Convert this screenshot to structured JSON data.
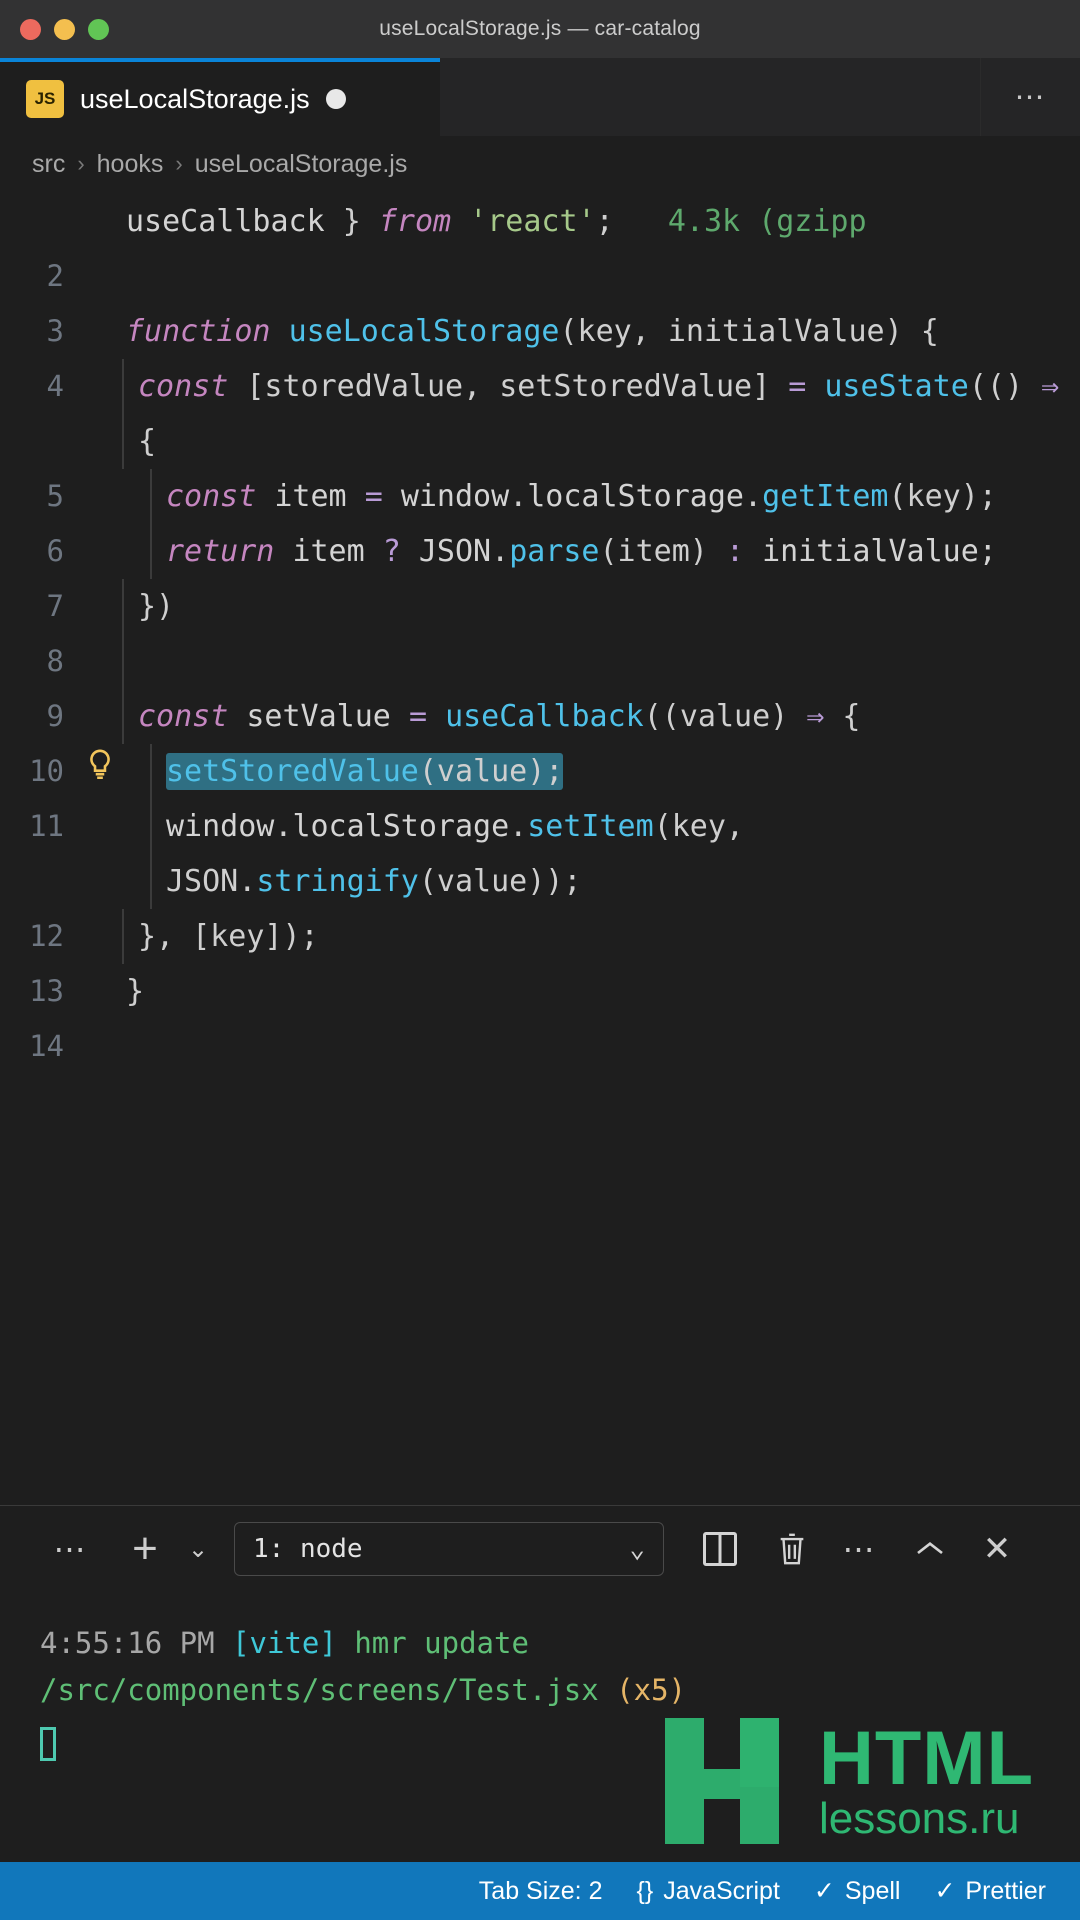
{
  "titlebar": {
    "title": "useLocalStorage.js — car-catalog",
    "traffic_lights": [
      "close-red",
      "minimize-yellow",
      "maximize-green"
    ],
    "colors": {
      "red": "#ec6a5e",
      "yellow": "#f4bf4f",
      "green": "#61c555"
    }
  },
  "tabbar": {
    "active_tab": {
      "icon": "JS",
      "label": "useLocalStorage.js",
      "dirty": true
    },
    "more_actions": "⋯"
  },
  "breadcrumb": {
    "items": [
      "src",
      "hooks",
      "useLocalStorage.js"
    ],
    "separator": "›"
  },
  "editor": {
    "language": "JavaScript",
    "lines": [
      {
        "number": "",
        "bulb": false,
        "indent": 0,
        "tokens": [
          {
            "t": "useCallback ",
            "c": "plain"
          },
          {
            "t": "} ",
            "c": "punc"
          },
          {
            "t": "from ",
            "c": "kw"
          },
          {
            "t": "'react'",
            "c": "strq"
          },
          {
            "t": ";",
            "c": "punc"
          },
          {
            "t": "   4.3k (gzipp",
            "c": "cost"
          }
        ]
      },
      {
        "number": "2",
        "bulb": false,
        "indent": 0,
        "tokens": []
      },
      {
        "number": "3",
        "bulb": false,
        "indent": 0,
        "tokens": [
          {
            "t": "function ",
            "c": "kw"
          },
          {
            "t": "useLocalStorage",
            "c": "fn2"
          },
          {
            "t": "(key, initialValue) {",
            "c": "punc"
          }
        ]
      },
      {
        "number": "4",
        "bulb": false,
        "indent": 1,
        "tokens": [
          {
            "t": "const ",
            "c": "kw"
          },
          {
            "t": "[storedValue, setStoredValue] ",
            "c": "punc"
          },
          {
            "t": "= ",
            "c": "op"
          },
          {
            "t": "useState",
            "c": "fn2"
          },
          {
            "t": "(() ",
            "c": "punc"
          },
          {
            "t": "⇒",
            "c": "arrow"
          },
          {
            "t": " {",
            "c": "punc"
          }
        ]
      },
      {
        "number": "5",
        "bulb": false,
        "indent": 2,
        "tokens": [
          {
            "t": "const ",
            "c": "kw"
          },
          {
            "t": "item ",
            "c": "plain"
          },
          {
            "t": "= ",
            "c": "op"
          },
          {
            "t": "window",
            "c": "plain"
          },
          {
            "t": ".",
            "c": "punc"
          },
          {
            "t": "localStorage",
            "c": "plain"
          },
          {
            "t": ".",
            "c": "punc"
          },
          {
            "t": "getItem",
            "c": "fn2"
          },
          {
            "t": "(key);",
            "c": "punc"
          }
        ]
      },
      {
        "number": "6",
        "bulb": false,
        "indent": 2,
        "tokens": [
          {
            "t": "return ",
            "c": "kw"
          },
          {
            "t": "item ",
            "c": "plain"
          },
          {
            "t": "? ",
            "c": "op"
          },
          {
            "t": "JSON",
            "c": "plain"
          },
          {
            "t": ".",
            "c": "punc"
          },
          {
            "t": "parse",
            "c": "fn2"
          },
          {
            "t": "(item) ",
            "c": "punc"
          },
          {
            "t": ": ",
            "c": "op"
          },
          {
            "t": "initialValue;",
            "c": "plain"
          }
        ]
      },
      {
        "number": "7",
        "bulb": false,
        "indent": 1,
        "tokens": [
          {
            "t": "})",
            "c": "punc"
          }
        ]
      },
      {
        "number": "8",
        "bulb": false,
        "indent": 1,
        "tokens": []
      },
      {
        "number": "9",
        "bulb": false,
        "indent": 1,
        "tokens": [
          {
            "t": "const ",
            "c": "kw"
          },
          {
            "t": "setValue ",
            "c": "plain"
          },
          {
            "t": "= ",
            "c": "op"
          },
          {
            "t": "useCallback",
            "c": "fn2"
          },
          {
            "t": "((value) ",
            "c": "punc"
          },
          {
            "t": "⇒",
            "c": "arrow"
          },
          {
            "t": " {",
            "c": "punc"
          }
        ]
      },
      {
        "number": "10",
        "bulb": true,
        "indent": 2,
        "selected": true,
        "tokens": [
          {
            "t": "setStoredValue",
            "c": "fn2"
          },
          {
            "t": "(value);",
            "c": "punc"
          }
        ]
      },
      {
        "number": "11",
        "bulb": false,
        "indent": 2,
        "tokens": [
          {
            "t": "window",
            "c": "plain"
          },
          {
            "t": ".",
            "c": "punc"
          },
          {
            "t": "localStorage",
            "c": "plain"
          },
          {
            "t": ".",
            "c": "punc"
          },
          {
            "t": "setItem",
            "c": "fn2"
          },
          {
            "t": "(key, JSON",
            "c": "punc"
          },
          {
            "t": ".",
            "c": "punc"
          },
          {
            "t": "stringify",
            "c": "fn2"
          },
          {
            "t": "(value));",
            "c": "punc"
          }
        ]
      },
      {
        "number": "12",
        "bulb": false,
        "indent": 1,
        "tokens": [
          {
            "t": "}, [key]);",
            "c": "punc"
          }
        ]
      },
      {
        "number": "13",
        "bulb": false,
        "indent": 0,
        "tokens": [
          {
            "t": "}",
            "c": "punc"
          }
        ]
      },
      {
        "number": "14",
        "bulb": false,
        "indent": 0,
        "tokens": []
      }
    ]
  },
  "panel": {
    "toolbar": {
      "left_more": "⋯",
      "new_terminal": "+",
      "new_terminal_caret": "⌄",
      "terminal_selected": "1: node",
      "terminal_caret": "⌄",
      "split_icon": "split-terminal-icon",
      "kill_icon": "trash-icon",
      "more_icon": "⋯",
      "maximize_icon": "⌃",
      "close_icon": "✕"
    },
    "output": {
      "time": "4:55:16 PM",
      "source": "[vite]",
      "message": "hmr update /src/components/screens/Test.jsx",
      "count": "(x5)"
    }
  },
  "watermark": {
    "title": "HTML",
    "subtitle": "lessons.ru",
    "color": "#2fb873"
  },
  "statusbar": {
    "items": [
      {
        "label": "Tab Size: 2",
        "icon": ""
      },
      {
        "label": "JavaScript",
        "icon": "{}"
      },
      {
        "label": "Spell",
        "icon": "✓"
      },
      {
        "label": "Prettier",
        "icon": "✓"
      }
    ],
    "background": "#1177bb"
  }
}
